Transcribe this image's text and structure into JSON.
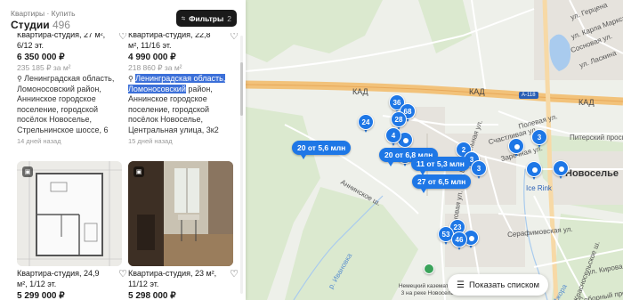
{
  "header": {
    "breadcrumb": "Квартиры · Купить",
    "title": "Студии",
    "count": "496",
    "filters_label": "Фильтры",
    "filters_count": "2"
  },
  "listings": [
    {
      "title": "Квартира-студия, 27 м², 6/12 эт.",
      "price": "6 350 000 ₽",
      "price_per_m": "235 185 ₽ за м²",
      "address": "Ленинградская область, Ломоносовский район, Аннинское городское поселение, городской посёлок Новоселье, Стрельнинское шоссе, 6",
      "ago": "14 дней назад"
    },
    {
      "title": "Квартира-студия, 22,8 м², 11/16 эт.",
      "price": "4 990 000 ₽",
      "price_per_m": "218 860 ₽ за м²",
      "address_hl": "Ленинградская область, Ломоносовский",
      "address_rest": " район, Аннинское городское поселение, городской посёлок Новоселье, Центральная улица, 3к2",
      "ago": "15 дней назад"
    },
    {
      "title": "Квартира-студия, 24,9 м², 1/12 эт.",
      "price": "5 299 000 ₽"
    },
    {
      "title": "Квартира-студия, 23 м², 11/12 эт.",
      "price": "5 298 000 ₽"
    }
  ],
  "map": {
    "show_list_label": "Показать списком",
    "city": "Новоселье",
    "poi": "Ice Rink",
    "memorial": "Немецкий каземат DL-3 на реке Новоселье",
    "road_kad": "КАД",
    "shield": "А-118",
    "streets": [
      "Центральная ул.",
      "Аннинское ш.",
      "Рябиновая ул.",
      "Заречная ул.",
      "Полевая ул.",
      "Счастливая ул.",
      "Питерский просп.",
      "Серафимовская ул.",
      "Красносельское ш.",
      "ул. Кирова",
      "р. Ивановка",
      "ул. Герцена",
      "ул. Карла Маркса",
      "Сосновая ул.",
      "ул. Ласкина",
      "р. Ижора",
      "Соборный просп."
    ],
    "clusters": [
      "36",
      "68",
      "28",
      "24",
      "4",
      "2",
      "3",
      "3",
      "3",
      "23",
      "53",
      "46"
    ],
    "price_pills": [
      "20 от 5,6 млн",
      "20 от 6,8 млн",
      "11 от 5,3 млн",
      "27 от 6,5 млн"
    ]
  },
  "colors": {
    "accent": "#1e77e6",
    "highlight": "#3b6fd8",
    "road": "#f2c27a"
  }
}
